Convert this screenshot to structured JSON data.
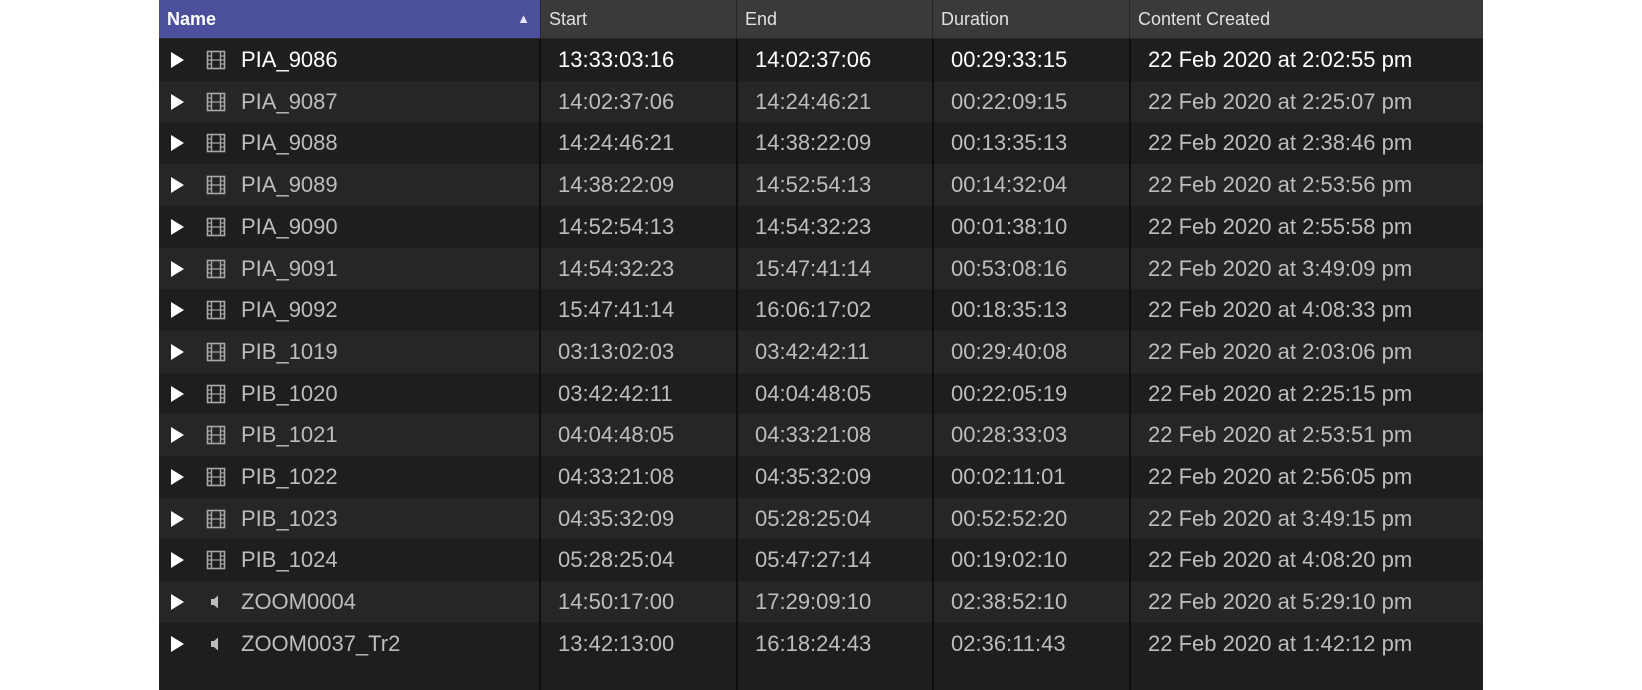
{
  "columns": {
    "name": "Name",
    "start": "Start",
    "end": "End",
    "duration": "Duration",
    "created": "Content Created"
  },
  "sort_indicator": "▲",
  "rows": [
    {
      "name": "PIA_9086",
      "type": "video",
      "start": "13:33:03:16",
      "end": "14:02:37:06",
      "duration": "00:29:33:15",
      "created": "22 Feb 2020 at 2:02:55 pm",
      "selected": true
    },
    {
      "name": "PIA_9087",
      "type": "video",
      "start": "14:02:37:06",
      "end": "14:24:46:21",
      "duration": "00:22:09:15",
      "created": "22 Feb 2020 at 2:25:07 pm"
    },
    {
      "name": "PIA_9088",
      "type": "video",
      "start": "14:24:46:21",
      "end": "14:38:22:09",
      "duration": "00:13:35:13",
      "created": "22 Feb 2020 at 2:38:46 pm"
    },
    {
      "name": "PIA_9089",
      "type": "video",
      "start": "14:38:22:09",
      "end": "14:52:54:13",
      "duration": "00:14:32:04",
      "created": "22 Feb 2020 at 2:53:56 pm"
    },
    {
      "name": "PIA_9090",
      "type": "video",
      "start": "14:52:54:13",
      "end": "14:54:32:23",
      "duration": "00:01:38:10",
      "created": "22 Feb 2020 at 2:55:58 pm"
    },
    {
      "name": "PIA_9091",
      "type": "video",
      "start": "14:54:32:23",
      "end": "15:47:41:14",
      "duration": "00:53:08:16",
      "created": "22 Feb 2020 at 3:49:09 pm"
    },
    {
      "name": "PIA_9092",
      "type": "video",
      "start": "15:47:41:14",
      "end": "16:06:17:02",
      "duration": "00:18:35:13",
      "created": "22 Feb 2020 at 4:08:33 pm"
    },
    {
      "name": "PIB_1019",
      "type": "video",
      "start": "03:13:02:03",
      "end": "03:42:42:11",
      "duration": "00:29:40:08",
      "created": "22 Feb 2020 at 2:03:06 pm"
    },
    {
      "name": "PIB_1020",
      "type": "video",
      "start": "03:42:42:11",
      "end": "04:04:48:05",
      "duration": "00:22:05:19",
      "created": "22 Feb 2020 at 2:25:15 pm"
    },
    {
      "name": "PIB_1021",
      "type": "video",
      "start": "04:04:48:05",
      "end": "04:33:21:08",
      "duration": "00:28:33:03",
      "created": "22 Feb 2020 at 2:53:51 pm"
    },
    {
      "name": "PIB_1022",
      "type": "video",
      "start": "04:33:21:08",
      "end": "04:35:32:09",
      "duration": "00:02:11:01",
      "created": "22 Feb 2020 at 2:56:05 pm"
    },
    {
      "name": "PIB_1023",
      "type": "video",
      "start": "04:35:32:09",
      "end": "05:28:25:04",
      "duration": "00:52:52:20",
      "created": "22 Feb 2020 at 3:49:15 pm"
    },
    {
      "name": "PIB_1024",
      "type": "video",
      "start": "05:28:25:04",
      "end": "05:47:27:14",
      "duration": "00:19:02:10",
      "created": "22 Feb 2020 at 4:08:20 pm"
    },
    {
      "name": "ZOOM0004",
      "type": "audio",
      "start": "14:50:17:00",
      "end": "17:29:09:10",
      "duration": "02:38:52:10",
      "created": "22 Feb 2020 at 5:29:10 pm"
    },
    {
      "name": "ZOOM0037_Tr2",
      "type": "audio",
      "start": "13:42:13:00",
      "end": "16:18:24:43",
      "duration": "02:36:11:43",
      "created": "22 Feb 2020 at 1:42:12 pm"
    }
  ],
  "colors": {
    "header_bg": "#3a3a3a",
    "name_header_bg": "#4c4f9c",
    "list_bg": "#1e1e1e"
  }
}
